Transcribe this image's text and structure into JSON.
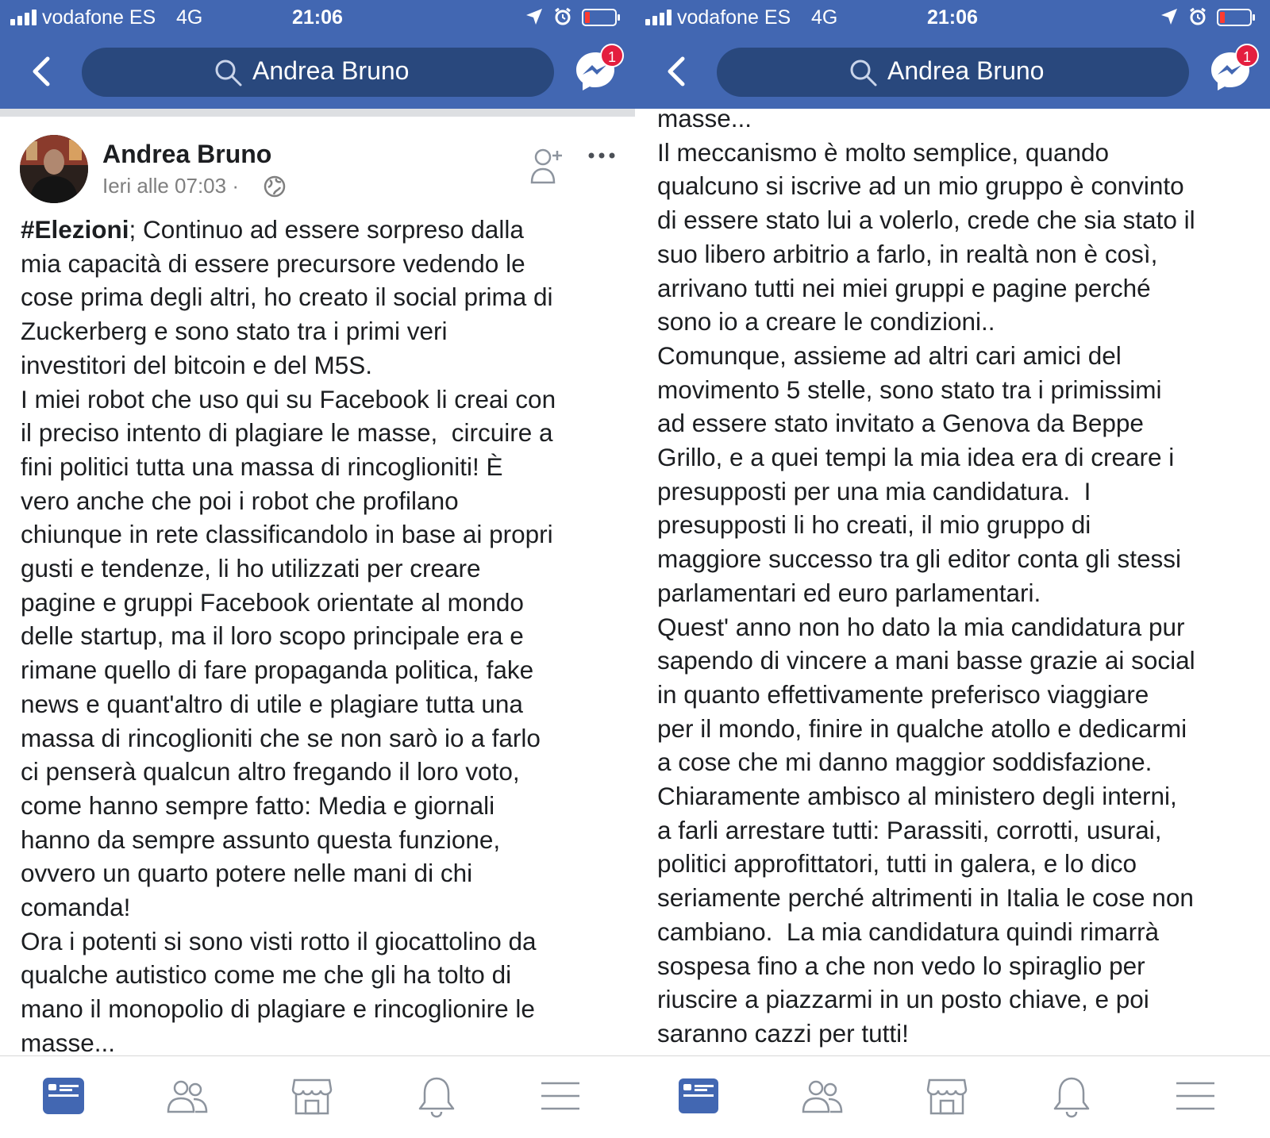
{
  "status_bar": {
    "carrier": "vodafone ES",
    "network": "4G",
    "time": "21:06"
  },
  "search": {
    "query": "Andrea Bruno"
  },
  "messenger": {
    "badge_count": "1"
  },
  "post": {
    "author": "Andrea Bruno",
    "timestamp": "Ieri alle 07:03 ·",
    "hashtag": "#Elezioni",
    "text_part1": "; Continuo ad essere sorpreso dalla\nmia capacità di essere precursore vedendo le\ncose prima degli altri, ho creato il social prima di\nZuckerberg e sono stato tra i primi veri\ninvestitori del bitcoin e del M5S.\nI miei robot che uso qui su Facebook li creai con\nil preciso intento di plagiare le masse,  circuire a\nfini politici tutta una massa di rincoglioniti! È\nvero anche che poi i robot che profilano\nchiunque in rete classificandolo in base ai propri\ngusti e tendenze, li ho utilizzati per creare\npagine e gruppi Facebook orientate al mondo\ndelle startup, ma il loro scopo principale era e\nrimane quello di fare propaganda politica, fake\nnews e quant'altro di utile e plagiare tutta una\nmassa di rincoglioniti che se non sarò io a farlo\nci penserà qualcun altro fregando il loro voto,\ncome hanno sempre fatto: Media e giornali\nhanno da sempre assunto questa funzione,\novvero un quarto potere nelle mani di chi\ncomanda!\nOra i potenti si sono visti rotto il giocattolino da\nqualche autistico come me che gli ha tolto di\nmano il monopolio di plagiare e rincoglionire le\nmasse...",
    "text_part2": "masse...\nIl meccanismo è molto semplice, quando\nqualcuno si iscrive ad un mio gruppo è convinto\ndi essere stato lui a volerlo, crede che sia stato il\nsuo libero arbitrio a farlo, in realtà non è così,\narrivano tutti nei miei gruppi e pagine perché\nsono io a creare le condizioni..\nComunque, assieme ad altri cari amici del\nmovimento 5 stelle, sono stato tra i primissimi\nad essere stato invitato a Genova da Beppe\nGrillo, e a quei tempi la mia idea era di creare i\npresupposti per una mia candidatura.  I\npresupposti li ho creati, il mio gruppo di\nmaggiore successo tra gli editor conta gli stessi\nparlamentari ed euro parlamentari.\nQuest' anno non ho dato la mia candidatura pur\nsapendo di vincere a mani basse grazie ai social\nin quanto effettivamente preferisco viaggiare\nper il mondo, finire in qualche atollo e dedicarmi\na cose che mi danno maggior soddisfazione.\nChiaramente ambisco al ministero degli interni,\na farli arrestare tutti: Parassiti, corrotti, usurai,\npolitici approfittatori, tutti in galera, e lo dico\nseriamente perché altrimenti in Italia le cose non\ncambiano.  La mia candidatura quindi rimarrà\nsospesa fino a che non vedo lo spiraglio per\nriuscire a piazzarmi in un posto chiave, e poi\nsaranno cazzi per tutti!"
  },
  "icons": {
    "back": "back-arrow-icon",
    "search": "search-icon",
    "messenger": "messenger-icon",
    "globe": "globe-icon",
    "add_friend": "add-friend-icon",
    "more": "more-dots-icon",
    "tabs": [
      "news-feed-icon",
      "friends-icon",
      "marketplace-icon",
      "notifications-icon",
      "menu-icon"
    ]
  },
  "colors": {
    "brand_blue": "#4267b2",
    "search_bg": "#29487d",
    "badge_red": "#e41e3f",
    "active_tab": "#4267b2"
  }
}
